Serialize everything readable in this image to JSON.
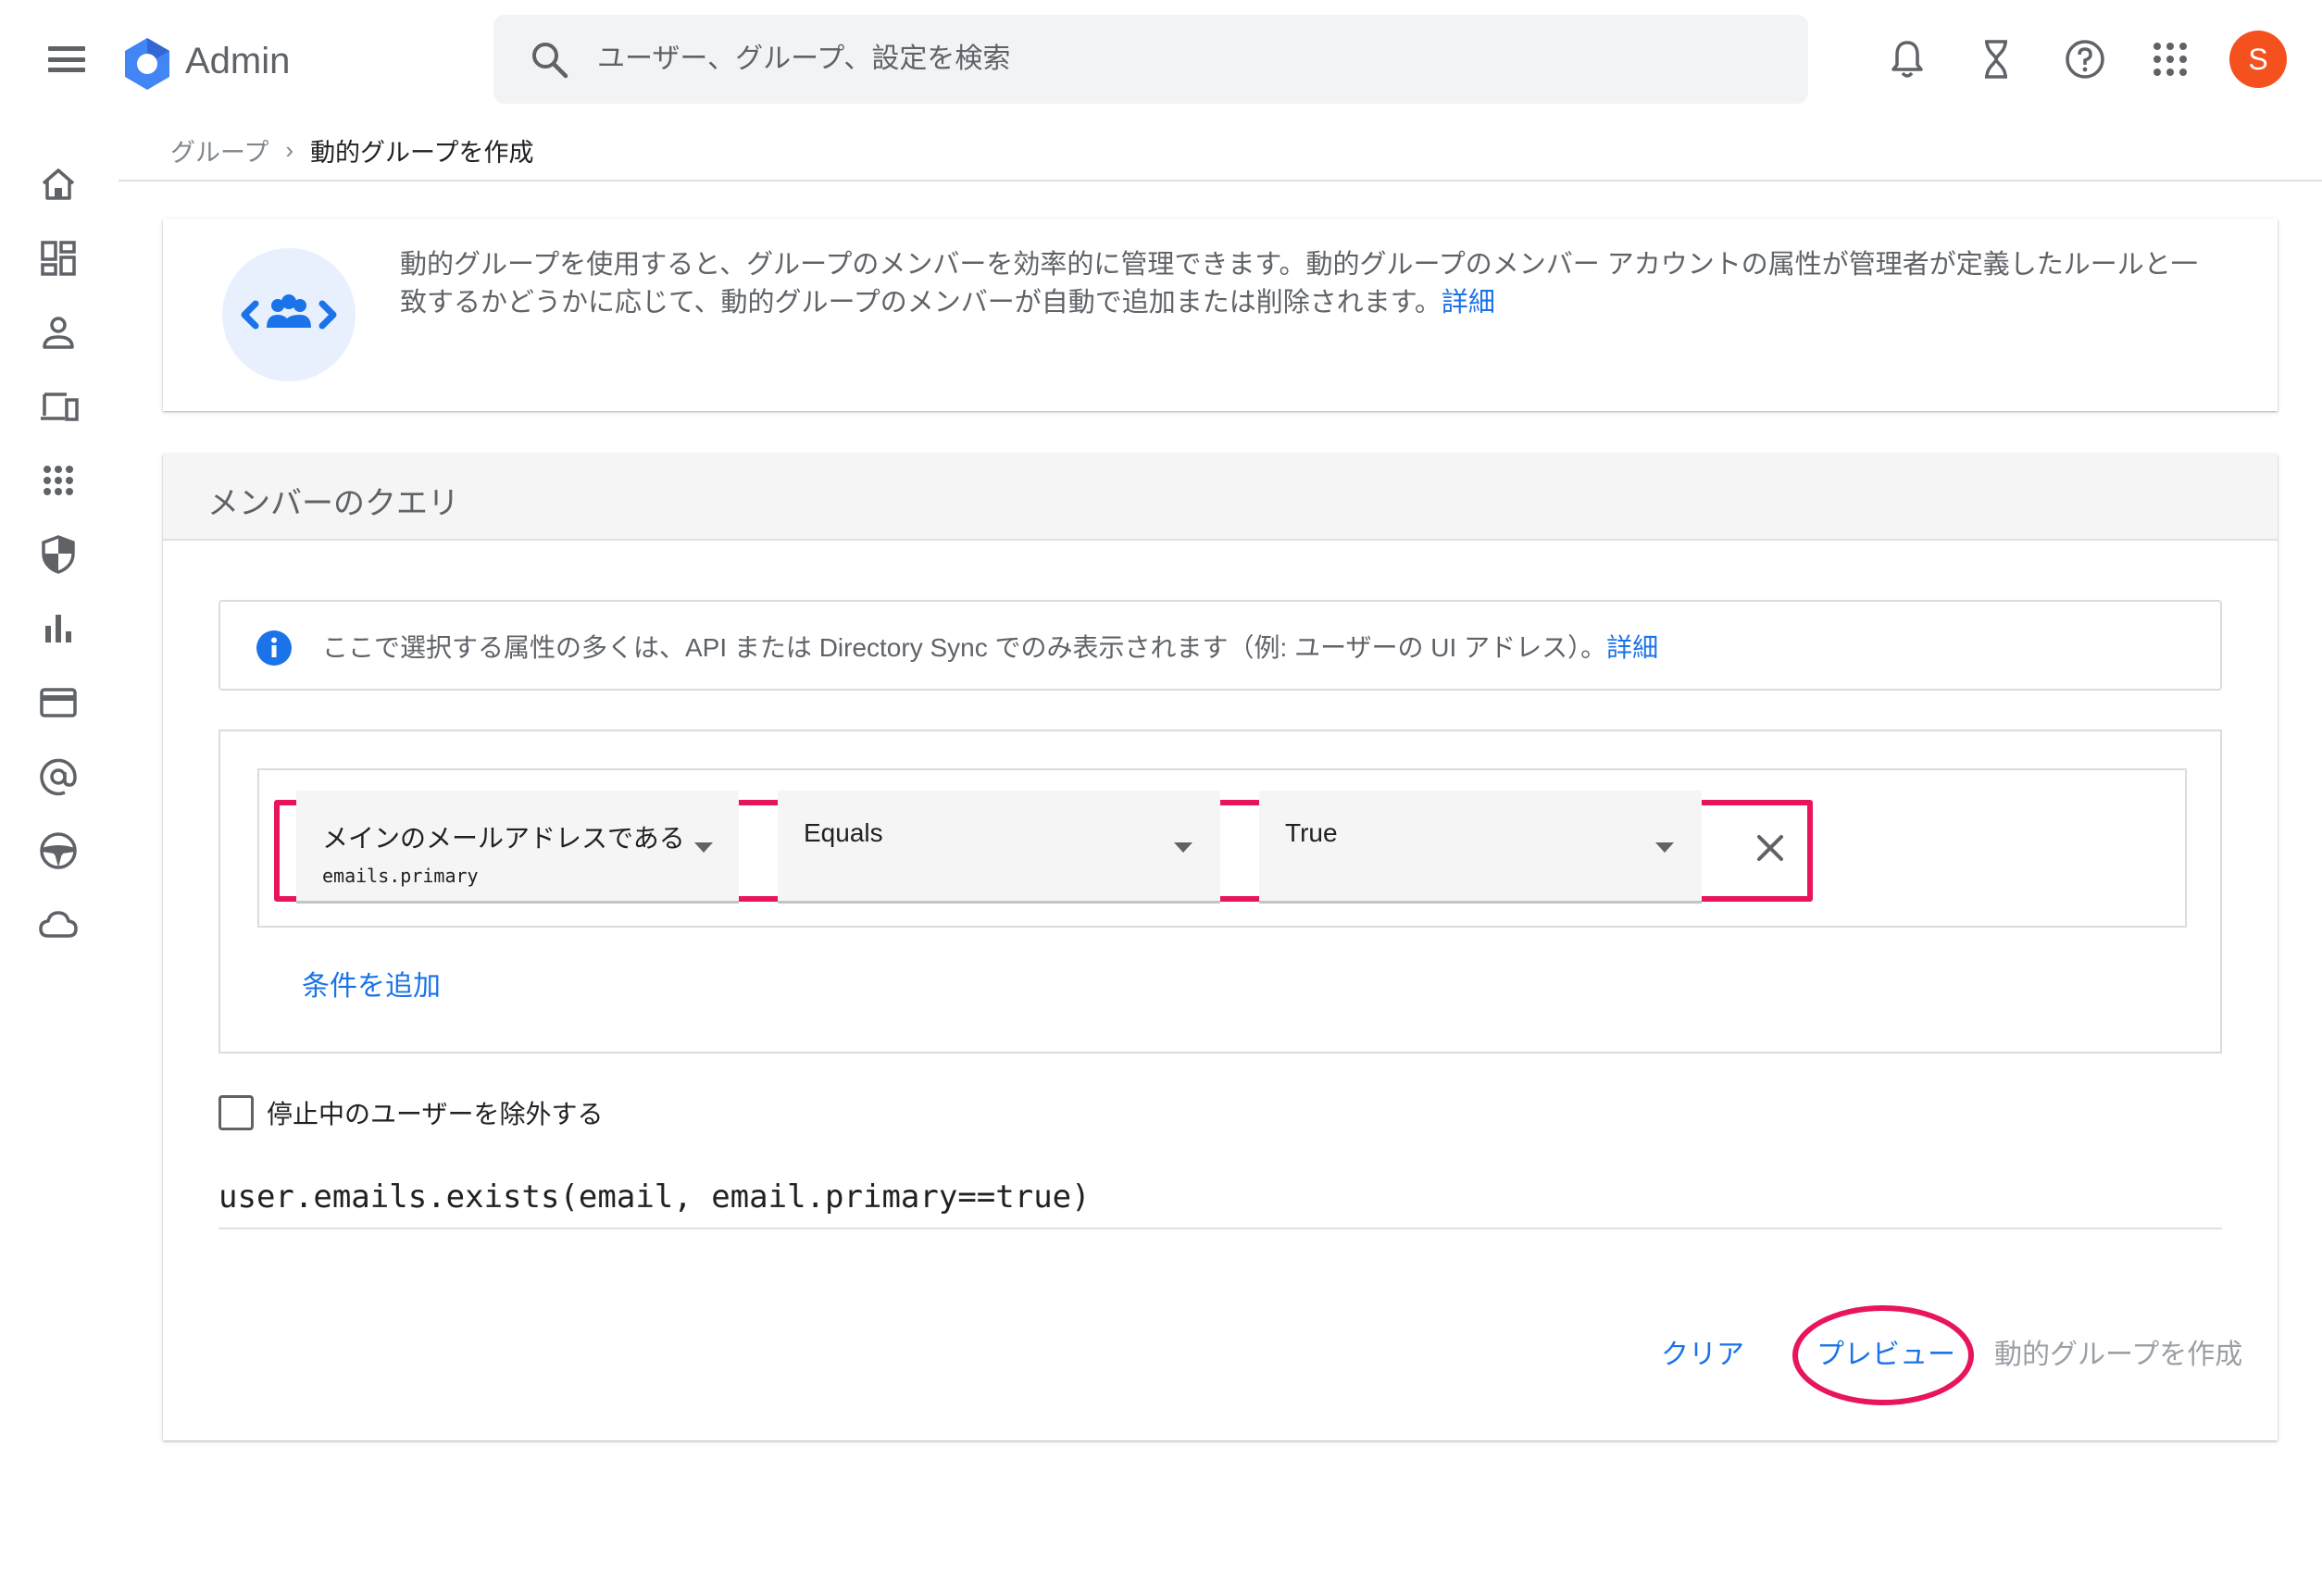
{
  "header": {
    "brand": "Admin",
    "search_placeholder": "ユーザー、グループ、設定を検索",
    "avatar_initial": "S"
  },
  "breadcrumb": {
    "parent": "グループ",
    "separator": "›",
    "current": "動的グループを作成"
  },
  "intro": {
    "text": "動的グループを使用すると、グループのメンバーを効率的に管理できます。動的グループのメンバー アカウントの属性が管理者が定義したルールと一致するかどうかに応じて、動的グループのメンバーが自動で追加または削除されます。",
    "link": "詳細"
  },
  "query": {
    "title": "メンバーのクエリ",
    "info_text": "ここで選択する属性の多くは、API または Directory Sync でのみ表示されます（例: ユーザーの UI アドレス）。",
    "info_link": "詳細",
    "rule": {
      "attribute_label": "メインのメールアドレスである",
      "attribute_key": "emails.primary",
      "operator": "Equals",
      "value": "True"
    },
    "add_condition": "条件を追加",
    "exclude_suspended_label": "停止中のユーザーを除外する",
    "exclude_suspended_checked": false,
    "expression": "user.emails.exists(email, email.primary==true)"
  },
  "actions": {
    "clear": "クリア",
    "preview": "プレビュー",
    "create": "動的グループを作成"
  },
  "colors": {
    "accent": "#1a73e8",
    "highlight": "#e8155a",
    "avatar": "#f4511e"
  }
}
